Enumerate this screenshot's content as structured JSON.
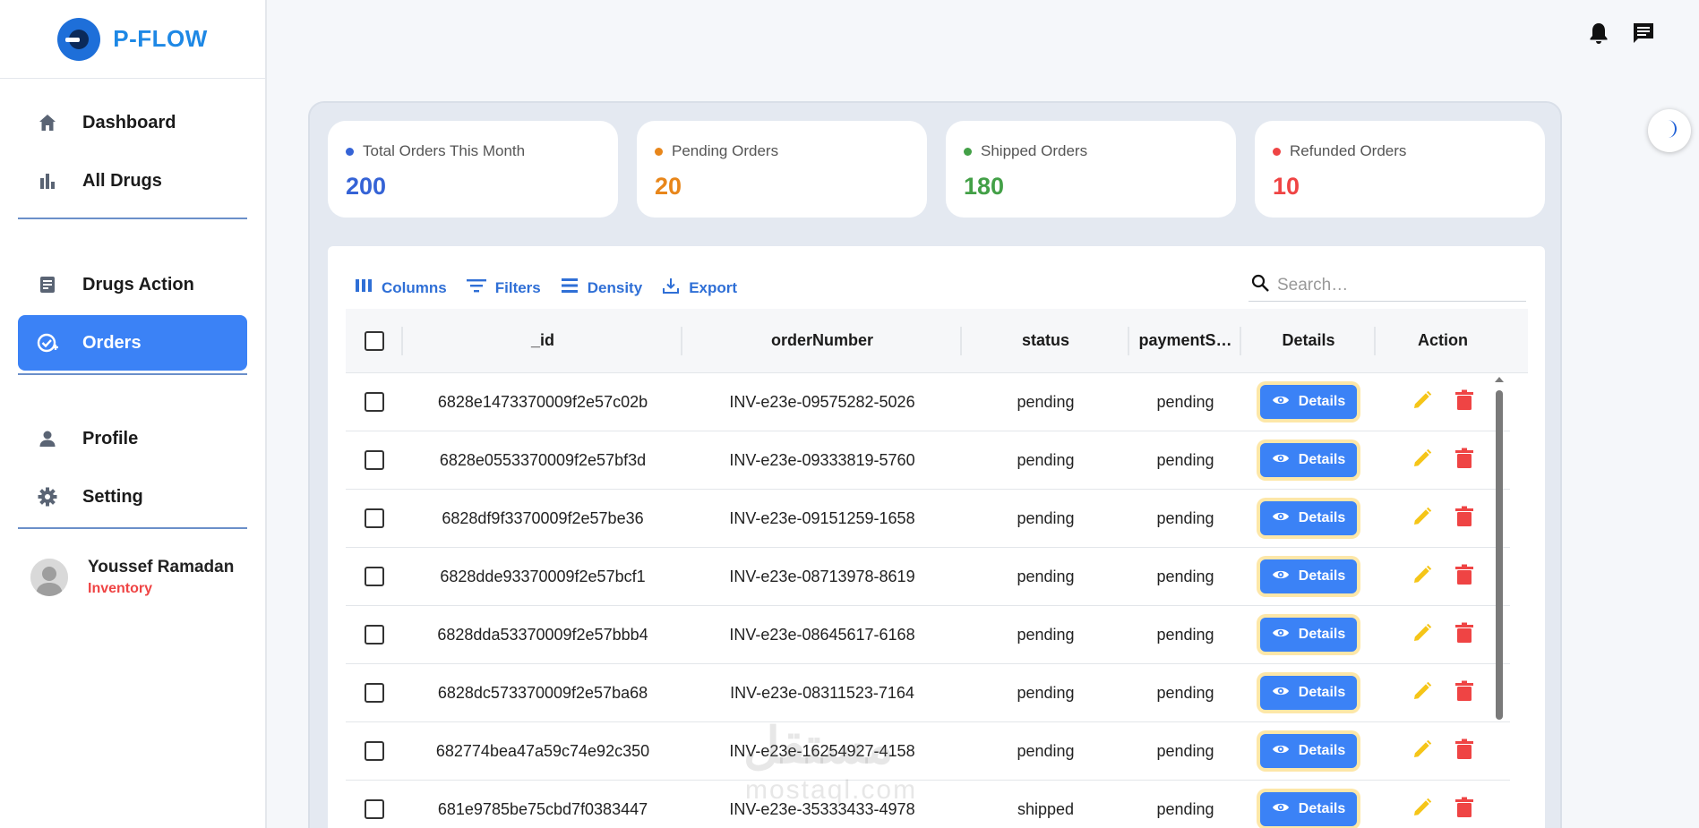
{
  "brand": {
    "name": "P-FLOW"
  },
  "sidebar": {
    "groups": [
      [
        {
          "label": "Dashboard",
          "icon": "home-icon"
        },
        {
          "label": "All Drugs",
          "icon": "bar-chart-icon"
        }
      ],
      [
        {
          "label": "Drugs Action",
          "icon": "document-icon"
        },
        {
          "label": "Orders",
          "icon": "check-badge-icon",
          "active": true
        }
      ],
      [
        {
          "label": "Profile",
          "icon": "person-icon"
        },
        {
          "label": "Setting",
          "icon": "gear-icon"
        }
      ]
    ]
  },
  "user": {
    "name": "Youssef Ramadan",
    "role": "Inventory"
  },
  "stats": [
    {
      "label": "Total Orders This Month",
      "value": "200",
      "color": "#3563d6"
    },
    {
      "label": "Pending Orders",
      "value": "20",
      "color": "#e8861a"
    },
    {
      "label": "Shipped Orders",
      "value": "180",
      "color": "#43a047"
    },
    {
      "label": "Refunded Orders",
      "value": "10",
      "color": "#ef4444"
    }
  ],
  "toolbar": {
    "columns": "Columns",
    "filters": "Filters",
    "density": "Density",
    "export": "Export"
  },
  "search": {
    "placeholder": "Search…"
  },
  "table": {
    "headers": {
      "id": "_id",
      "orderNumber": "orderNumber",
      "status": "status",
      "payment": "paymentS…",
      "details": "Details",
      "action": "Action"
    },
    "details_label": "Details",
    "rows": [
      {
        "id": "6828e1473370009f2e57c02b",
        "orderNumber": "INV-e23e-09575282-5026",
        "status": "pending",
        "payment": "pending"
      },
      {
        "id": "6828e0553370009f2e57bf3d",
        "orderNumber": "INV-e23e-09333819-5760",
        "status": "pending",
        "payment": "pending"
      },
      {
        "id": "6828df9f3370009f2e57be36",
        "orderNumber": "INV-e23e-09151259-1658",
        "status": "pending",
        "payment": "pending"
      },
      {
        "id": "6828dde93370009f2e57bcf1",
        "orderNumber": "INV-e23e-08713978-8619",
        "status": "pending",
        "payment": "pending"
      },
      {
        "id": "6828dda53370009f2e57bbb4",
        "orderNumber": "INV-e23e-08645617-6168",
        "status": "pending",
        "payment": "pending"
      },
      {
        "id": "6828dc573370009f2e57ba68",
        "orderNumber": "INV-e23e-08311523-7164",
        "status": "pending",
        "payment": "pending"
      },
      {
        "id": "682774bea47a59c74e92c350",
        "orderNumber": "INV-e23e-16254927-4158",
        "status": "pending",
        "payment": "pending"
      },
      {
        "id": "681e9785be75cbd7f0383447",
        "orderNumber": "INV-e23e-35333433-4978",
        "status": "shipped",
        "payment": "pending"
      }
    ]
  },
  "watermark": {
    "line1": "مستقل",
    "line2": "mostaql.com"
  }
}
